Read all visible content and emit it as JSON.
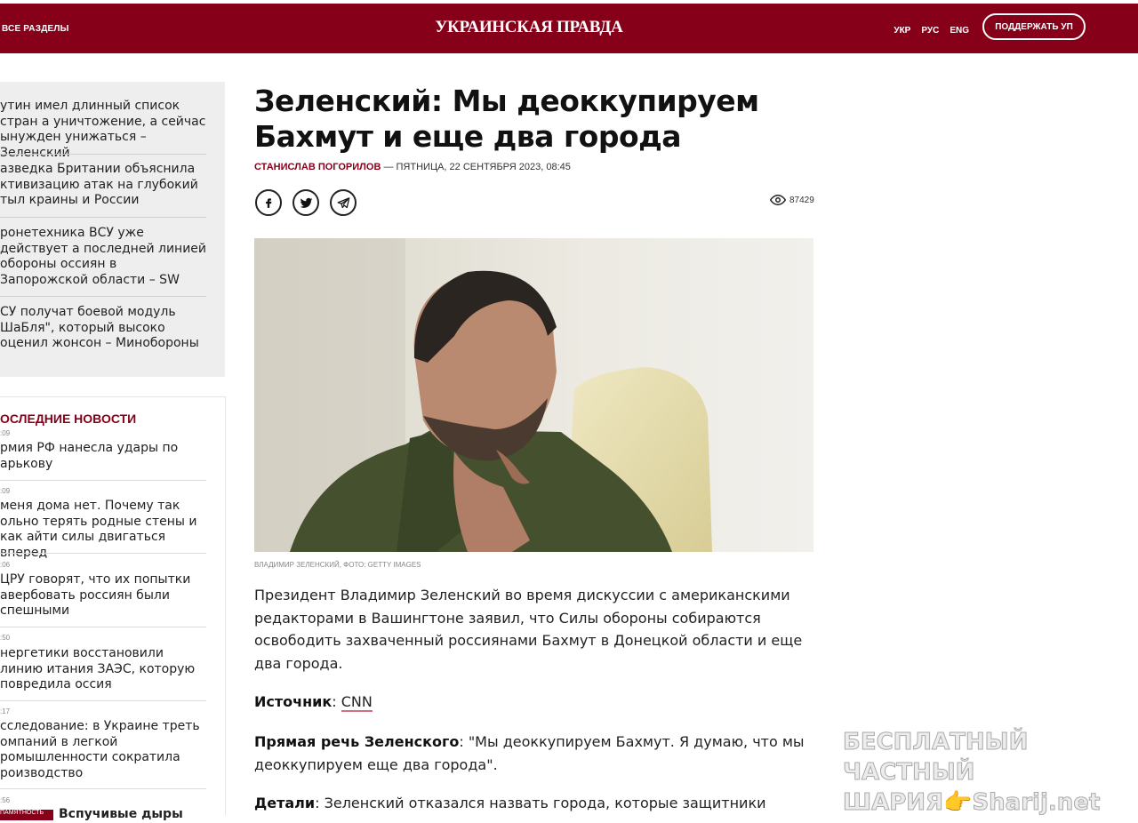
{
  "header": {
    "all_sections": "ВСЕ РАЗДЕЛЫ",
    "logo": "УКРАИНСКАЯ ПРАВДА",
    "langs": [
      "УКР",
      "РУС",
      "ENG"
    ],
    "support": "ПОДДЕРЖАТЬ УП",
    "color": "#860019"
  },
  "related": [
    "утин имел длинный список стран а уничтожение, а сейчас ынужден унижаться – Зеленский",
    "азведка Британии объяснила ктивизацию атак на глубокий тыл краины и России",
    "ронетехника ВСУ уже действует а последней линией обороны оссиян в Запорожской области – SW",
    "СУ получат боевой модуль ШаБля\", который высоко оценил жонсон – Минобороны"
  ],
  "latest": {
    "title": "ОСЛЕДНИЕ НОВОСТИ",
    "items": [
      {
        "time": ":09",
        "text": "рмия РФ нанесла удары по арькову"
      },
      {
        "time": ":09",
        "text": " меня дома нет. Почему так ольно терять родные стены и как айти силы двигаться вперед"
      },
      {
        "time": ":06",
        "text": " ЦРУ говорят, что их попытки авербовать россиян были спешными"
      },
      {
        "time": ":50",
        "text": "нергетики восстановили линию итания ЗАЭС, которую повредила оссия"
      },
      {
        "time": ":17",
        "text": "сследование: в Украине треть омпаний в легкой ромышленности сократила роизводство"
      },
      {
        "time": ":56",
        "text": "Вспучивые дыры"
      }
    ],
    "badge": "ПАМЯТНОСТЬ"
  },
  "article": {
    "title": "Зеленский: Мы деоккупируем Бахмут и еще два города",
    "author": "СТАНИСЛАВ ПОГОРИЛОВ",
    "date": " — ПЯТНИЦА, 22 СЕНТЯБРЯ 2023, 08:45",
    "views": "87429",
    "caption": "Владимир Зеленский, Фото: Getty Images",
    "lead": "Президент Владимир Зеленский во время дискуссии с американскими редакторами в Вашингтоне заявил, что Силы обороны собираются освободить захваченный россиянами Бахмут в Донецкой области и еще два города.",
    "source_label": "Источник",
    "source_link": "CNN",
    "quote_label": "Прямая речь Зеленского",
    "quote_text": ": \"Мы деоккупируем Бахмут. Я думаю, что мы деоккупируем еще два города\".",
    "details_label": "Детали",
    "details_text": ": Зеленский отказался назвать города, которые защитники"
  },
  "watermark": {
    "line1": "БЕСПЛАТНЫЙ ЧАСТНЫЙ",
    "line2": "ШАРИЯ👉Sharij.net"
  }
}
